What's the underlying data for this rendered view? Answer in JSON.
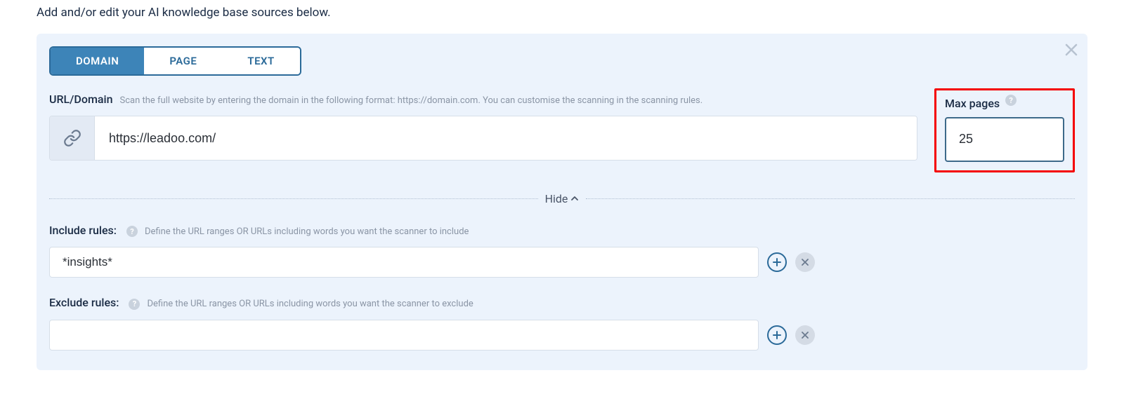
{
  "intro": "Add and/or edit your AI knowledge base sources below.",
  "tabs": {
    "domain": "DOMAIN",
    "page": "PAGE",
    "text": "TEXT"
  },
  "url_section": {
    "label": "URL/Domain",
    "hint": "Scan the full website by entering the domain in the following format: https://domain.com. You can customise the scanning in the scanning rules.",
    "value": "https://leadoo.com/"
  },
  "maxpages": {
    "label": "Max pages",
    "value": "25"
  },
  "hide_label": "Hide",
  "include_rules": {
    "label": "Include rules:",
    "hint": "Define the URL ranges OR URLs including words you want the scanner to include",
    "value": "*insights*"
  },
  "exclude_rules": {
    "label": "Exclude rules:",
    "hint": "Define the URL ranges OR URLs including words you want the scanner to exclude",
    "value": ""
  }
}
